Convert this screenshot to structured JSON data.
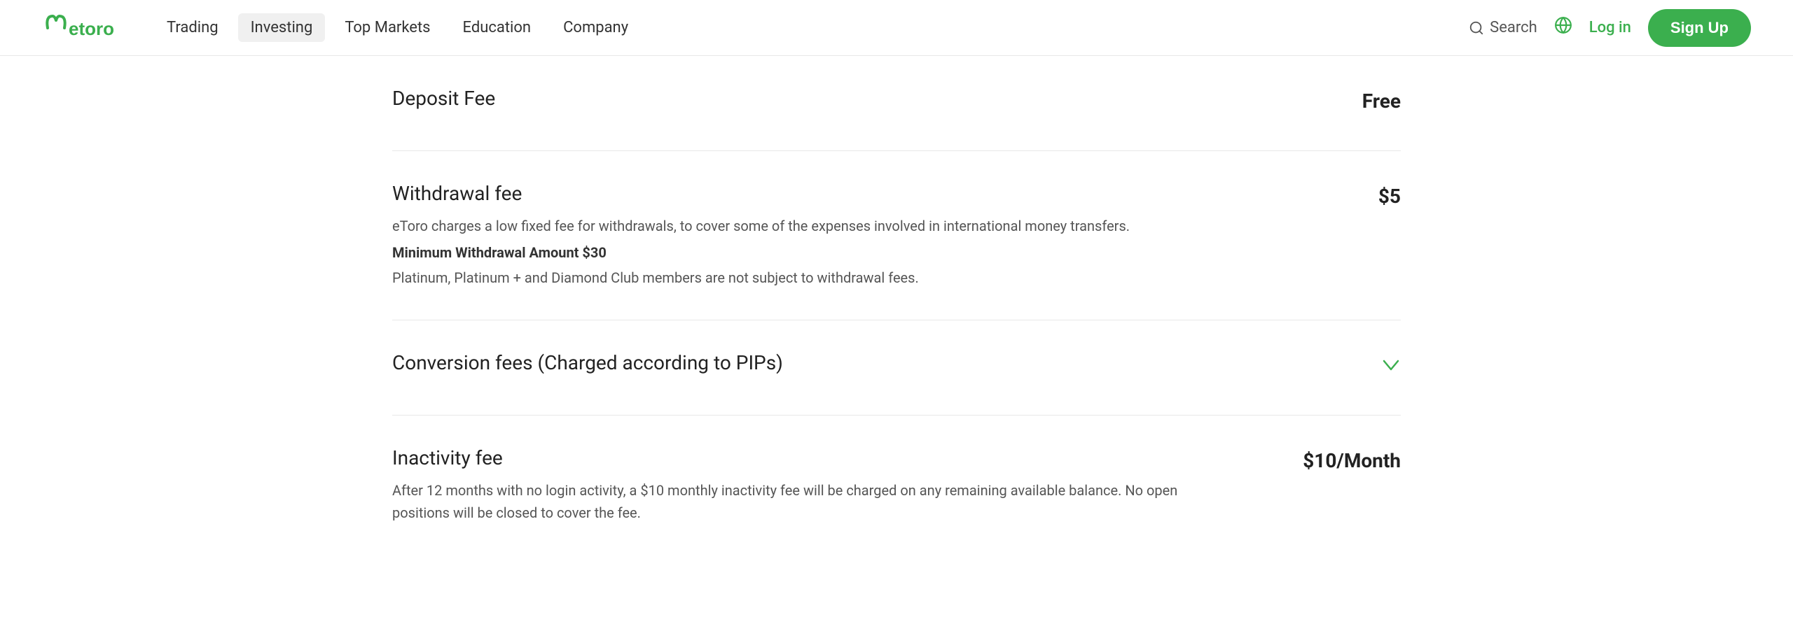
{
  "navbar": {
    "logo_text": "etoro",
    "nav_items": [
      {
        "label": "Trading",
        "active": false
      },
      {
        "label": "Investing",
        "active": true
      },
      {
        "label": "Top Markets",
        "active": false
      },
      {
        "label": "Education",
        "active": false
      },
      {
        "label": "Company",
        "active": false
      }
    ],
    "search_label": "Search",
    "login_label": "Log in",
    "signup_label": "Sign Up"
  },
  "fees": [
    {
      "title": "Deposit Fee",
      "description": "",
      "value": "Free",
      "has_chevron": false
    },
    {
      "title": "Withdrawal fee",
      "description": "eToro charges a low fixed fee for withdrawals, to cover some of the expenses involved in international money transfers.",
      "bold_line": "Minimum Withdrawal Amount $30",
      "note_line": "Platinum, Platinum + and Diamond Club members are not subject to withdrawal fees.",
      "value": "$5",
      "has_chevron": false
    },
    {
      "title": "Conversion fees (Charged according to PIPs)",
      "description": "",
      "value": "",
      "has_chevron": true
    },
    {
      "title": "Inactivity fee",
      "description": "After 12 months with no login activity, a $10 monthly inactivity fee will be charged on any remaining available balance. No open positions will be closed to cover the fee.",
      "value": "$10/Month",
      "has_chevron": false
    }
  ],
  "icons": {
    "search": "🔍",
    "globe": "🌐",
    "chevron_down": "∨"
  }
}
